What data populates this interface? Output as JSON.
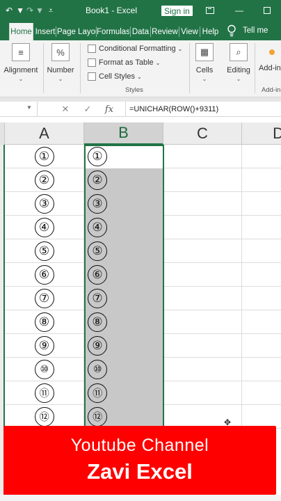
{
  "titlebar": {
    "undo_icon": "undo-icon",
    "redo_icon": "redo-icon",
    "qat_dropdown_icon": "customize-qat-icon",
    "doc_title": "Book1  -  Excel",
    "sign_in": "Sign in",
    "ribbon_display_icon": "ribbon-display-icon",
    "minimize_icon": "minimize-icon",
    "maximize_icon": "maximize-icon"
  },
  "tabs": [
    "Home",
    "Insert",
    "Page Layout",
    "Formulas",
    "Data",
    "Review",
    "View",
    "Help"
  ],
  "active_tab": "Home",
  "tell_me": "Tell me",
  "ribbon": {
    "alignment": "Alignment",
    "number": "Number",
    "number_icon": "%",
    "conditional_formatting": "Conditional Formatting",
    "format_as_table": "Format as Table",
    "cell_styles": "Cell Styles",
    "styles_group": "Styles",
    "cells": "Cells",
    "editing": "Editing",
    "addins": "Add-ins",
    "addins_group": "Add-in"
  },
  "formula_bar": {
    "cancel_icon": "✕",
    "enter_icon": "✓",
    "fx_icon": "fx",
    "formula": "=UNICHAR(ROW()+9311)"
  },
  "columns": [
    "A",
    "B",
    "C",
    "D"
  ],
  "selected_column": "B",
  "rows": [
    {
      "a": "①",
      "b": "①"
    },
    {
      "a": "②",
      "b": "②"
    },
    {
      "a": "③",
      "b": "③"
    },
    {
      "a": "④",
      "b": "④"
    },
    {
      "a": "⑤",
      "b": "⑤"
    },
    {
      "a": "⑥",
      "b": "⑥"
    },
    {
      "a": "⑦",
      "b": "⑦"
    },
    {
      "a": "⑧",
      "b": "⑧"
    },
    {
      "a": "⑨",
      "b": "⑨"
    },
    {
      "a": "⑩",
      "b": "⑩"
    },
    {
      "a": "⑪",
      "b": "⑪"
    },
    {
      "a": "⑫",
      "b": "⑫"
    }
  ],
  "colors": {
    "excel_green": "#217346",
    "banner_red": "#ff0000",
    "selection_fill": "#c8c8c8"
  },
  "banner": {
    "line1": "Youtube Channel",
    "line2": "Zavi Excel"
  }
}
